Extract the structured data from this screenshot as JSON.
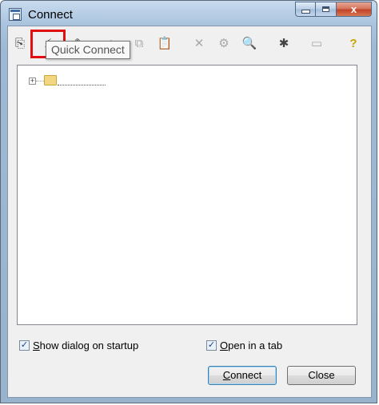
{
  "window": {
    "title": "Connect",
    "controls": {
      "minimize": "minimize",
      "maximize": "maximize",
      "close": "x"
    }
  },
  "toolbar": {
    "buttons": [
      {
        "name": "new-session",
        "glyph": "⎘",
        "disabled": false
      },
      {
        "name": "quick-connect",
        "glyph": "⚡",
        "disabled": false,
        "highlighted": true
      },
      {
        "name": "properties",
        "glyph": "✎",
        "disabled": false
      },
      {
        "name": "cut",
        "glyph": "✂",
        "disabled": true
      },
      {
        "name": "copy",
        "glyph": "⧉",
        "disabled": true
      },
      {
        "name": "paste",
        "glyph": "📋",
        "disabled": true
      },
      {
        "name": "delete",
        "glyph": "✕",
        "disabled": true
      },
      {
        "name": "session-options",
        "glyph": "⚙",
        "disabled": true
      },
      {
        "name": "find",
        "glyph": "🔍",
        "disabled": false
      },
      {
        "name": "new-folder",
        "glyph": "✱",
        "disabled": false
      },
      {
        "name": "desktop-shortcut",
        "glyph": "▭",
        "disabled": true
      },
      {
        "name": "help",
        "glyph": "?",
        "disabled": false
      }
    ]
  },
  "tooltip": {
    "text": "Quick Connect"
  },
  "options": {
    "show_dialog_on_startup": {
      "prefix": "",
      "accel": "S",
      "rest": "how dialog on startup",
      "checked": true
    },
    "open_in_tab": {
      "prefix": "",
      "accel": "O",
      "rest": "pen in a tab",
      "checked": true
    }
  },
  "buttons": {
    "connect": {
      "accel": "C",
      "rest": "onnect"
    },
    "close": {
      "label": "Close"
    }
  }
}
